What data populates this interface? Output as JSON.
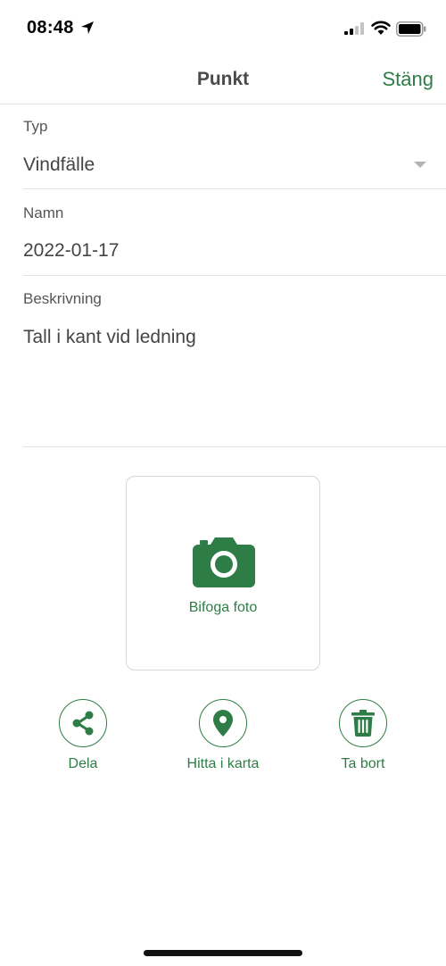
{
  "status_bar": {
    "time": "08:48"
  },
  "nav": {
    "title": "Punkt",
    "close_label": "Stäng"
  },
  "form": {
    "type": {
      "label": "Typ",
      "value": "Vindfälle"
    },
    "name": {
      "label": "Namn",
      "value": "2022-01-17"
    },
    "description": {
      "label": "Beskrivning",
      "value": "Tall i kant vid ledning"
    }
  },
  "photo": {
    "label": "Bifoga foto",
    "icon": "camera-icon"
  },
  "actions": [
    {
      "label": "Dela",
      "icon": "share-icon"
    },
    {
      "label": "Hitta i karta",
      "icon": "map-pin-icon"
    },
    {
      "label": "Ta bort",
      "icon": "trash-icon"
    }
  ],
  "colors": {
    "accent": "#2e7d46",
    "divider": "#e3e3e3",
    "text": "#444444"
  }
}
